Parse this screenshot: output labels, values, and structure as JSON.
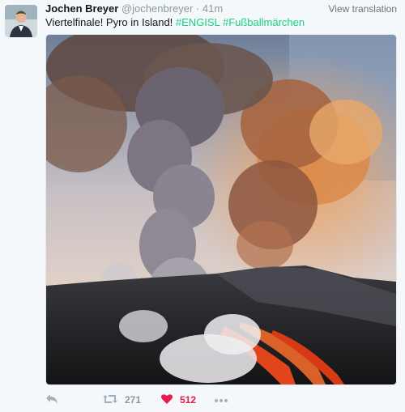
{
  "tweet": {
    "name": "Jochen Breyer",
    "handle": "@jochenbreyer",
    "separator": "·",
    "time": "41m",
    "view_translation": "View translation",
    "text_plain": "Viertelfinale! Pyro in Island! ",
    "hashtag_1": "#ENGISL",
    "hashtag_2": "#Fußballmärchen",
    "media_alt": "Volcanic eruption with lava flows and smoke plumes"
  },
  "actions": {
    "reply_icon": "reply-icon",
    "retweet_icon": "retweet-icon",
    "retweet_count": "271",
    "like_icon": "heart-icon",
    "like_count": "512",
    "more_icon": "more-dots-icon"
  },
  "colors": {
    "hashtag": "#19cf86",
    "like": "#e81c4f",
    "muted": "#8899a6",
    "background": "#f5f8fa"
  }
}
